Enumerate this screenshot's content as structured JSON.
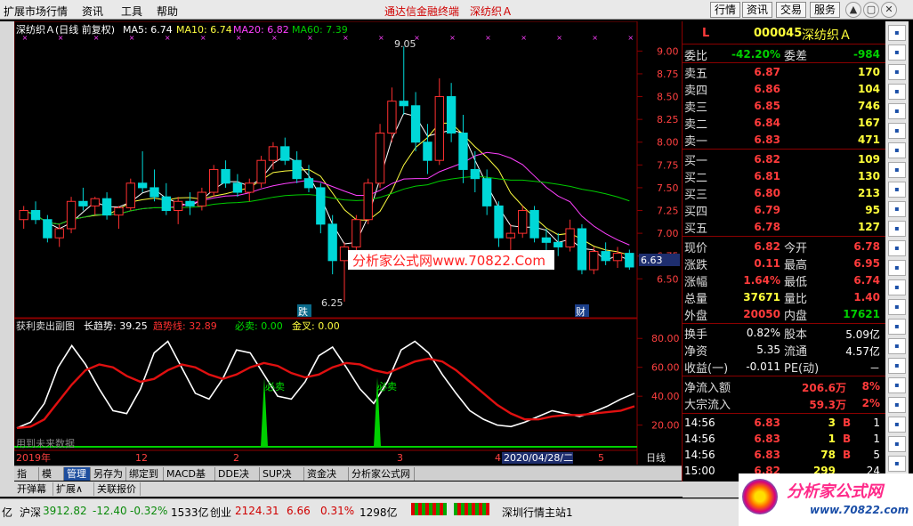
{
  "menu": {
    "items": [
      "扩展市场行情",
      "资讯",
      "工具",
      "帮助"
    ],
    "center_title": "通达信金融终端",
    "center_stock": "深纺织Ａ"
  },
  "toolbar": {
    "buttons": [
      "行情",
      "资讯",
      "交易",
      "服务"
    ]
  },
  "chart": {
    "header": {
      "title": "深纺织Ａ(日线 前复权)",
      "ma5": "MA5: 6.74",
      "ma10": "MA10: 6.74",
      "ma20": "MA20: 6.82",
      "ma60": "MA60: 7.39"
    },
    "price_axis": [
      "9.00",
      "8.75",
      "8.50",
      "8.25",
      "8.00",
      "7.75",
      "7.50",
      "7.25",
      "7.00",
      "6.75",
      "6.50"
    ],
    "price_ticks": [
      9.0,
      8.75,
      8.5,
      8.25,
      8.0,
      7.75,
      7.5,
      7.25,
      7.0,
      6.75,
      6.5
    ],
    "current_price_tag": "6.63",
    "high_label": "9.05",
    "low_label": "6.25",
    "marker_die": "跌",
    "marker_cai": "财",
    "watermark": "分析家公式网www.70822.Com",
    "ma_colors": {
      "ma5": "#ffffff",
      "ma10": "#ffff40",
      "ma20": "#ff40ff",
      "ma60": "#00cc00"
    },
    "sub": {
      "title": "获利卖出副图",
      "long_trend": "长趋势: 39.25",
      "trend_line": "趋势线: 32.89",
      "must_sell": "必卖: 0.00",
      "golden_cross": "金叉: 0.00",
      "axis": [
        "80.00",
        "60.00",
        "40.00",
        "20.00"
      ],
      "axis_values": [
        80,
        60,
        40,
        20
      ],
      "sell_label": "必卖",
      "footer_text": "用到未来数据"
    },
    "date_axis": {
      "year": "2019年",
      "m12": "12",
      "m2": "2",
      "m3": "3",
      "m4": "4",
      "m5": "5",
      "current_date": "2020/04/28/二",
      "period": "日线"
    }
  },
  "chart_data": {
    "type": "candlestick",
    "ylim": [
      6.2,
      9.15
    ],
    "candles": [
      [
        7.15,
        7.3,
        7.05,
        7.25
      ],
      [
        7.25,
        7.35,
        7.1,
        7.15
      ],
      [
        7.15,
        7.2,
        6.9,
        6.95
      ],
      [
        6.95,
        7.1,
        6.85,
        7.05
      ],
      [
        7.05,
        7.4,
        7.0,
        7.35
      ],
      [
        7.35,
        7.5,
        7.25,
        7.3
      ],
      [
        7.3,
        7.4,
        7.2,
        7.38
      ],
      [
        7.38,
        7.45,
        7.15,
        7.2
      ],
      [
        7.2,
        7.3,
        7.05,
        7.28
      ],
      [
        7.28,
        7.6,
        7.25,
        7.55
      ],
      [
        7.55,
        7.9,
        7.45,
        7.5
      ],
      [
        7.5,
        7.7,
        7.35,
        7.4
      ],
      [
        7.4,
        7.55,
        7.2,
        7.25
      ],
      [
        7.25,
        7.4,
        7.1,
        7.35
      ],
      [
        7.35,
        7.45,
        7.2,
        7.3
      ],
      [
        7.3,
        7.5,
        7.25,
        7.45
      ],
      [
        7.45,
        7.75,
        7.4,
        7.7
      ],
      [
        7.7,
        7.8,
        7.5,
        7.55
      ],
      [
        7.55,
        7.65,
        7.4,
        7.45
      ],
      [
        7.45,
        7.6,
        7.35,
        7.55
      ],
      [
        7.55,
        7.85,
        7.5,
        7.8
      ],
      [
        7.8,
        8.0,
        7.7,
        7.95
      ],
      [
        7.95,
        8.05,
        7.75,
        7.8
      ],
      [
        7.8,
        7.9,
        7.55,
        7.6
      ],
      [
        7.6,
        7.75,
        7.45,
        7.5
      ],
      [
        7.5,
        7.55,
        7.0,
        7.1
      ],
      [
        7.1,
        7.2,
        6.55,
        6.7
      ],
      [
        6.7,
        6.9,
        6.25,
        6.85
      ],
      [
        6.85,
        7.2,
        6.8,
        7.15
      ],
      [
        7.15,
        7.6,
        7.1,
        7.55
      ],
      [
        7.55,
        8.2,
        7.5,
        8.1
      ],
      [
        8.1,
        8.6,
        8.0,
        8.45
      ],
      [
        8.45,
        9.05,
        8.3,
        8.4
      ],
      [
        8.4,
        8.55,
        7.9,
        8.0
      ],
      [
        8.0,
        8.2,
        7.65,
        7.8
      ],
      [
        7.8,
        8.7,
        7.75,
        8.5
      ],
      [
        8.5,
        8.65,
        8.0,
        8.1
      ],
      [
        8.1,
        8.3,
        7.55,
        7.7
      ],
      [
        7.7,
        7.9,
        7.45,
        7.6
      ],
      [
        7.6,
        7.7,
        7.2,
        7.3
      ],
      [
        7.3,
        7.35,
        6.85,
        6.95
      ],
      [
        6.95,
        7.1,
        6.8,
        7.0
      ],
      [
        7.0,
        7.3,
        6.95,
        7.25
      ],
      [
        7.25,
        7.3,
        6.9,
        6.95
      ],
      [
        6.95,
        7.05,
        6.8,
        6.9
      ],
      [
        6.9,
        7.0,
        6.75,
        6.85
      ],
      [
        6.85,
        7.15,
        6.8,
        7.05
      ],
      [
        7.05,
        7.1,
        6.55,
        6.6
      ],
      [
        6.6,
        6.85,
        6.55,
        6.8
      ],
      [
        6.8,
        6.9,
        6.65,
        6.7
      ],
      [
        6.7,
        6.85,
        6.62,
        6.78
      ],
      [
        6.78,
        6.82,
        6.6,
        6.63
      ]
    ],
    "sub_white": [
      18,
      22,
      35,
      60,
      75,
      62,
      45,
      30,
      28,
      45,
      70,
      78,
      60,
      42,
      38,
      52,
      72,
      70,
      55,
      40,
      38,
      50,
      68,
      74,
      60,
      45,
      35,
      50,
      72,
      78,
      70,
      55,
      42,
      30,
      24,
      20,
      19,
      22,
      26,
      30,
      28,
      26,
      29,
      33,
      38,
      42
    ],
    "sub_red": [
      18,
      19,
      24,
      36,
      48,
      58,
      62,
      60,
      54,
      50,
      52,
      58,
      62,
      60,
      55,
      52,
      55,
      60,
      63,
      61,
      56,
      53,
      55,
      60,
      63,
      62,
      58,
      56,
      60,
      64,
      66,
      64,
      58,
      50,
      42,
      34,
      28,
      24,
      24,
      26,
      27,
      27,
      28,
      29,
      30,
      33
    ]
  },
  "panel": {
    "code": "000045",
    "name": "深纺织Ａ",
    "flag": "L",
    "weibi_label": "委比",
    "weibi": "-42.20%",
    "weicha_label": "委差",
    "weicha": "-984",
    "asks": [
      {
        "label": "卖五",
        "price": "6.87",
        "vol": "170"
      },
      {
        "label": "卖四",
        "price": "6.86",
        "vol": "104"
      },
      {
        "label": "卖三",
        "price": "6.85",
        "vol": "746"
      },
      {
        "label": "卖二",
        "price": "6.84",
        "vol": "167"
      },
      {
        "label": "卖一",
        "price": "6.83",
        "vol": "471"
      }
    ],
    "bids": [
      {
        "label": "买一",
        "price": "6.82",
        "vol": "109"
      },
      {
        "label": "买二",
        "price": "6.81",
        "vol": "130"
      },
      {
        "label": "买三",
        "price": "6.80",
        "vol": "213"
      },
      {
        "label": "买四",
        "price": "6.79",
        "vol": "95"
      },
      {
        "label": "买五",
        "price": "6.78",
        "vol": "127"
      }
    ],
    "stats": [
      {
        "l1": "现价",
        "v1": "6.82",
        "l2": "今开",
        "v2": "6.78"
      },
      {
        "l1": "涨跌",
        "v1": "0.11",
        "l2": "最高",
        "v2": "6.95"
      },
      {
        "l1": "涨幅",
        "v1": "1.64%",
        "l2": "最低",
        "v2": "6.74"
      },
      {
        "l1": "总量",
        "v1": "37671",
        "l2": "量比",
        "v2": "1.40"
      },
      {
        "l1": "外盘",
        "v1": "20050",
        "l2": "内盘",
        "v2": "17621"
      }
    ],
    "fin": [
      {
        "l1": "换手",
        "v1": "0.82%",
        "l2": "股本",
        "v2": "5.09亿"
      },
      {
        "l1": "净资",
        "v1": "5.35",
        "l2": "流通",
        "v2": "4.57亿"
      },
      {
        "l1": "收益(一)",
        "v1": "-0.011",
        "l2": "PE(动)",
        "v2": "－"
      }
    ],
    "flows": [
      {
        "label": "净流入额",
        "value": "206.6万",
        "pct": "8%"
      },
      {
        "label": "大宗流入",
        "value": "59.3万",
        "pct": "2%"
      }
    ],
    "ticks": [
      {
        "time": "14:56",
        "price": "6.83",
        "vol": "3",
        "side": "B",
        "n": "1"
      },
      {
        "time": "14:56",
        "price": "6.83",
        "vol": "1",
        "side": "B",
        "n": "1"
      },
      {
        "time": "14:56",
        "price": "6.83",
        "vol": "78",
        "side": "B",
        "n": "5"
      },
      {
        "time": "15:00",
        "price": "6.82",
        "vol": "299",
        "side": "",
        "n": "24"
      }
    ],
    "bottom_tabs": [
      "笔",
      "价",
      "细",
      "势",
      "联"
    ]
  },
  "tabs": [
    "指标",
    "模板",
    "管理",
    "另存为",
    "绑定到",
    "MACD基本",
    "DDE决策",
    "SUP决策",
    "资金决策",
    "分析家公式网"
  ],
  "tabs2": [
    "开弹幕",
    "扩展∧",
    "关联报价"
  ],
  "status": {
    "yi": "亿",
    "hs_label": "沪深",
    "hs_val": "3912.82",
    "hs_chg": "-12.40",
    "hs_pct": "-0.32%",
    "hs_amt": "1533亿",
    "cy_label": "创业",
    "cy_val": "2124.31",
    "cy_chg": "6.66",
    "cy_pct": "0.31%",
    "cy_amt": "1298亿",
    "server": "深圳行情主站1"
  },
  "logo": {
    "title": "分析家公式网",
    "url": "www.70822.com"
  },
  "side_icons": [
    "arrow-up-icon",
    "arrow-down-icon",
    "fund-icon",
    "list-icon",
    "k-icon",
    "chart-icon",
    "grid-icon",
    "table-icon",
    "bar-icon",
    "f10-icon",
    "fiz-icon",
    "dde-icon",
    "rsi-icon",
    "ma-icon",
    "vol-icon",
    "info-icon",
    "calc-icon",
    "tool-icon",
    "search-icon",
    "pin-icon",
    "mail-icon",
    "help-icon",
    "settings-icon",
    "star-icon"
  ]
}
